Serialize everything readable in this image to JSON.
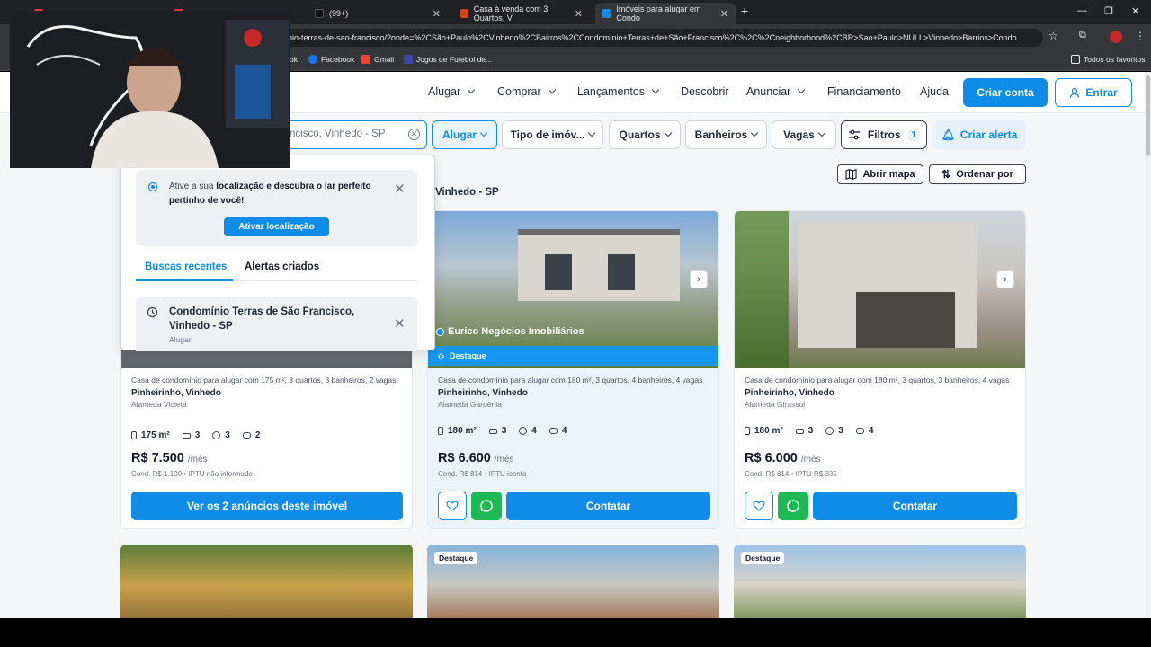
{
  "browser": {
    "tabs": [
      {
        "label": "",
        "active": false
      },
      {
        "label": "",
        "active": false
      },
      {
        "label": "(99+)",
        "active": false
      },
      {
        "label": "Casa à venda com 3 Quartos, V",
        "active": false
      },
      {
        "label": "Imóveis para alugar em Condo",
        "active": true
      }
    ],
    "url": "nio-terras-de-sao-francisco/?onde=%2CSão+Paulo%2CVinhedo%2CBairros%2CCondomínio+Terras+de+São+Francisco%2C%2C%2Cneighborhood%2CBR>Sao+Paulo>NULL>Vinhedo>Barrios>Condo...",
    "bookmarks": [
      "ok",
      "Facebook",
      "Gmail",
      "Jogos de Futebol de...",
      "Todos os favoritos"
    ]
  },
  "header": {
    "nav": [
      "Alugar",
      "Comprar",
      "Lançamentos",
      "Descobrir",
      "Anunciar",
      "Financiamento",
      "Ajuda"
    ],
    "criar_conta": "Criar conta",
    "entrar": "Entrar"
  },
  "filters": {
    "search_value": "ncisco, Vinhedo - SP",
    "mode": "Alugar",
    "tipo": "Tipo de imóv...",
    "quartos": "Quartos",
    "banheiros": "Banheiros",
    "vagas": "Vagas",
    "filtros": "Filtros",
    "filtros_count": "1",
    "criar_alerta": "Criar alerta"
  },
  "toolbar": {
    "abrir_mapa": "Abrir mapa",
    "ordenar": "Ordenar por"
  },
  "region_title": "Vinhedo - SP",
  "dropdown": {
    "loc_text_1": "Ative a sua",
    "loc_text_bold": "localização e descubra o lar perfeito pertinho de você!",
    "loc_button": "Ativar localização",
    "tab_recent": "Buscas recentes",
    "tab_alerts": "Alertas criados",
    "recent_title": "Condomínio Terras de São Francisco, Vinhedo - SP",
    "recent_sub": "Alugar"
  },
  "listings": [
    {
      "desc": "Casa de condomínio para alugar com 175 m², 3 quartos, 3 banheiros, 2 vagas",
      "loc": "Pinheirinho, Vinhedo",
      "street": "Alameda Violeta",
      "area": "175 m²",
      "quartos": "3",
      "banheiros": "3",
      "vagas": "2",
      "price": "R$ 7.500",
      "per": "/mês",
      "cond": "Cond. R$ 1.100 • IPTU não informado",
      "cta": "Ver os 2 anúncios deste imóvel"
    },
    {
      "badge": "Eurico Negócios Imobiliários",
      "destaque": "Destaque",
      "desc": "Casa de condomínio para alugar com 180 m², 3 quartos, 4 banheiros, 4 vagas",
      "loc": "Pinheirinho, Vinhedo",
      "street": "Alameda Gardênia",
      "area": "180 m²",
      "quartos": "3",
      "banheiros": "4",
      "vagas": "4",
      "price": "R$ 6.600",
      "per": "/mês",
      "cond": "Cond. R$ 814 • IPTU isento",
      "cta": "Contatar"
    },
    {
      "desc": "Casa de condomínio para alugar com 180 m², 3 quartos, 3 banheiros, 4 vagas",
      "loc": "Pinheirinho, Vinhedo",
      "street": "Alameda Girassol",
      "area": "180 m²",
      "quartos": "3",
      "banheiros": "3",
      "vagas": "4",
      "price": "R$ 6.000",
      "per": "/mês",
      "cond": "Cond. R$ 814 • IPTU R$ 335",
      "cta": "Contatar"
    }
  ],
  "row2_tags": [
    "Destaque",
    "Destaque"
  ],
  "colors": {
    "brand": "#0f8be8",
    "whatsapp": "#1db954"
  }
}
